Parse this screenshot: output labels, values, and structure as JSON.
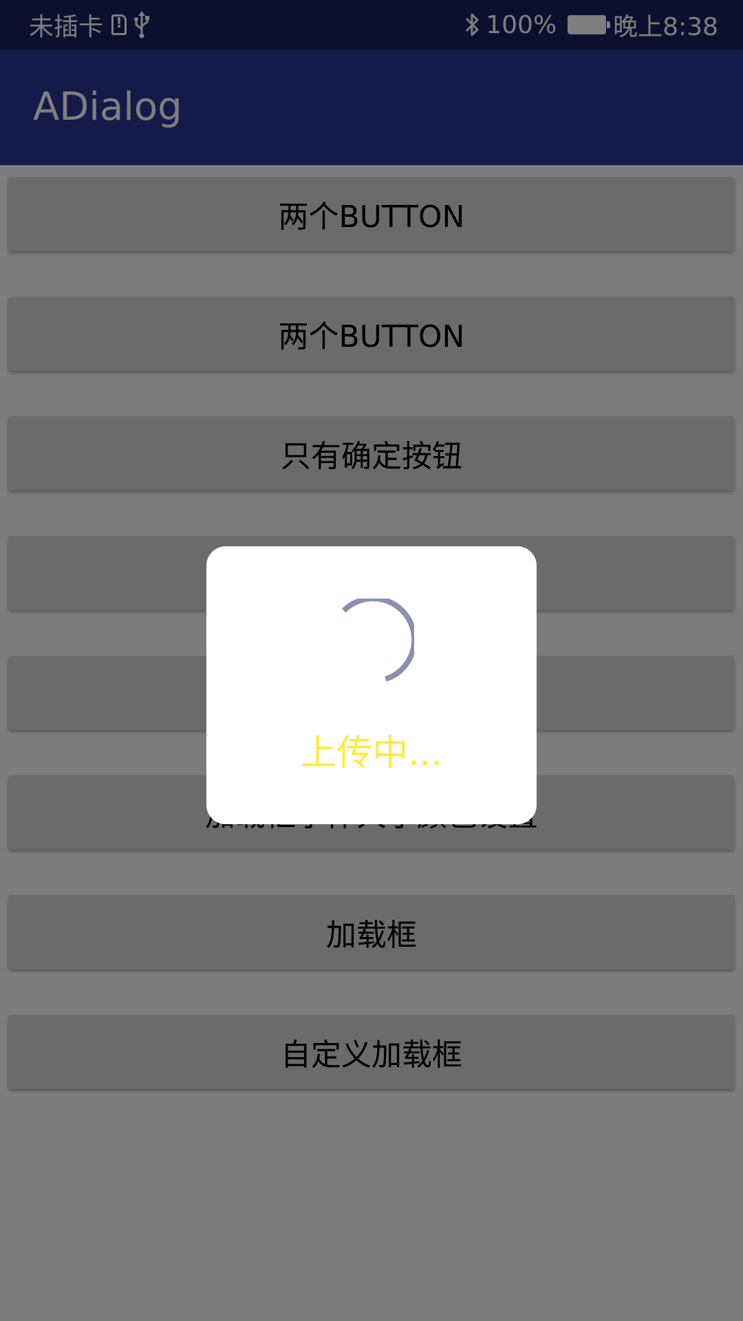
{
  "status_bar": {
    "carrier": "未插卡",
    "icons": [
      "sim-alert-icon",
      "usb-icon",
      "bluetooth-icon",
      "battery-charging-icon"
    ],
    "battery_percent": "100%",
    "time": "晚上8:38"
  },
  "app_bar": {
    "title": "ADialog"
  },
  "buttons": [
    {
      "label": "两个BUTTON"
    },
    {
      "label": "两个BUTTON"
    },
    {
      "label": "只有确定按钮"
    },
    {
      "label": ""
    },
    {
      "label": ""
    },
    {
      "label": "加载框字体大小颜色设置"
    },
    {
      "label": "加载框"
    },
    {
      "label": "自定义加载框"
    }
  ],
  "dialog": {
    "message": "上传中...",
    "message_color": "#ffeb3b"
  },
  "colors": {
    "status_bar": "#1a1f5c",
    "app_bar": "#283593",
    "button": "#d6d7d7",
    "spinner": "#8d8fb0"
  }
}
